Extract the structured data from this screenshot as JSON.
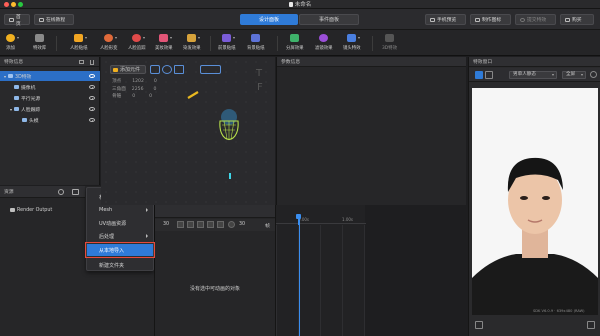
{
  "window": {
    "title": "未命名"
  },
  "topbar": {
    "home": "首页",
    "tutorial": "在线教程",
    "tab_design": "设计面板",
    "tab_events": "事件面板",
    "phone_preview": "手机预览",
    "make_icon": "制作图标",
    "submit": "提交特效",
    "buy": "购买"
  },
  "toolbar": {
    "items": [
      "添加",
      "特效库",
      "人脸贴纸",
      "人脸形变",
      "人脸追踪",
      "美妆效果",
      "染发效果",
      "前景贴纸",
      "背景贴纸",
      "分屏效果",
      "滤镜效果",
      "镜头特效",
      "3D特效"
    ]
  },
  "effects_panel": {
    "title": "特效信息",
    "tree": [
      "3D特效",
      "摄像机",
      "平行光源",
      "人脸跟踪",
      "头模"
    ]
  },
  "resources_panel": {
    "title": "资源",
    "item": "Render Output"
  },
  "context_menu": {
    "items": [
      "材质",
      "Mesh",
      "UV动画资源",
      "后处理",
      "从本地导入",
      "新建文件夹"
    ]
  },
  "viewport": {
    "add_animation": "添加元件",
    "stats": [
      {
        "label": "顶点",
        "value": "1202",
        "extra": "0"
      },
      {
        "label": "三角面",
        "value": "2256",
        "extra": "0"
      },
      {
        "label": "骨骼",
        "value": "0",
        "extra": "0"
      }
    ]
  },
  "timeline": {
    "frames": "30",
    "fps_label": "帧",
    "fps": "30",
    "marker_start": "0.00s",
    "marker_end": "1.00s",
    "empty_msg": "没有选中可动画的对象"
  },
  "params_panel": {
    "title": "参数信息"
  },
  "preview_panel": {
    "title": "特效窗口",
    "model_select": "男单人静态",
    "size_select": "全屏",
    "sdk_version": "SDK V6.0.9 · 639x480 (RAW)"
  },
  "colors": {
    "accent": "#2f7bd8",
    "highlight_border": "#e64a3c",
    "head_outline": "#b7e04a"
  }
}
